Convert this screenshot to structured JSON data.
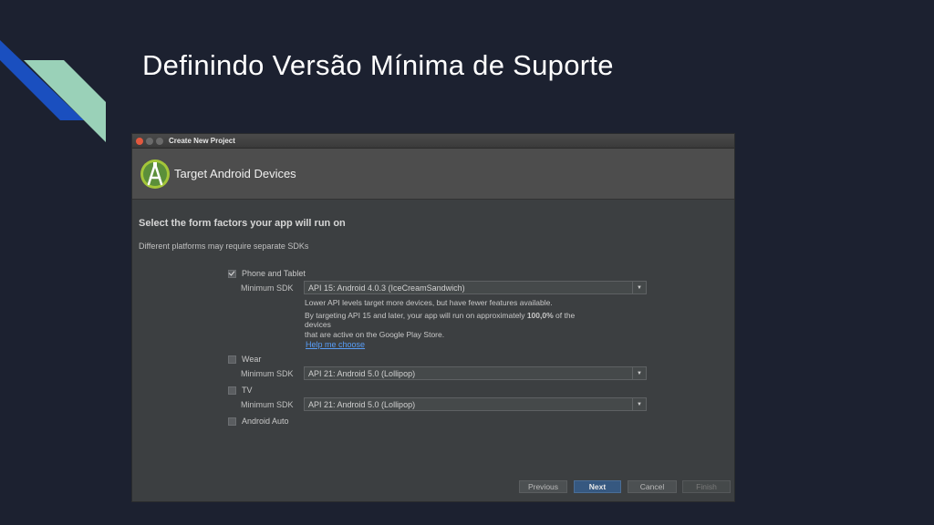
{
  "slide": {
    "title": "Definindo Versão Mínima de Suporte"
  },
  "window": {
    "titlebar": "Create New Project",
    "header_title": "Target Android Devices",
    "section_heading": "Select the form factors your app will run on",
    "section_sub": "Different platforms may require separate SDKs",
    "min_sdk_label": "Minimum SDK",
    "phone": {
      "label": "Phone and Tablet",
      "checked": true,
      "sdk": "API 15: Android 4.0.3 (IceCreamSandwich)",
      "info_line1": "Lower API levels target more devices, but have fewer features available.",
      "info_line2_pre": "By targeting API 15 and later, your app will run on approximately ",
      "info_line2_percent": "100,0%",
      "info_line2_post": " of the",
      "info_line3": "devices",
      "info_line4": "that are active on the Google Play Store.",
      "help_link": "Help me choose"
    },
    "wear": {
      "label": "Wear",
      "checked": false,
      "sdk": "API 21: Android 5.0 (Lollipop)"
    },
    "tv": {
      "label": "TV",
      "checked": false,
      "sdk": "API 21: Android 5.0 (Lollipop)"
    },
    "auto": {
      "label": "Android Auto",
      "checked": false
    },
    "buttons": {
      "previous": "Previous",
      "next": "Next",
      "cancel": "Cancel",
      "finish": "Finish"
    }
  },
  "colors": {
    "slide_bg": "#1c2130",
    "deco_blue": "#1a4fbf",
    "deco_green": "#9ad1b8",
    "android_green": "#a4c639",
    "link": "#589df6"
  }
}
